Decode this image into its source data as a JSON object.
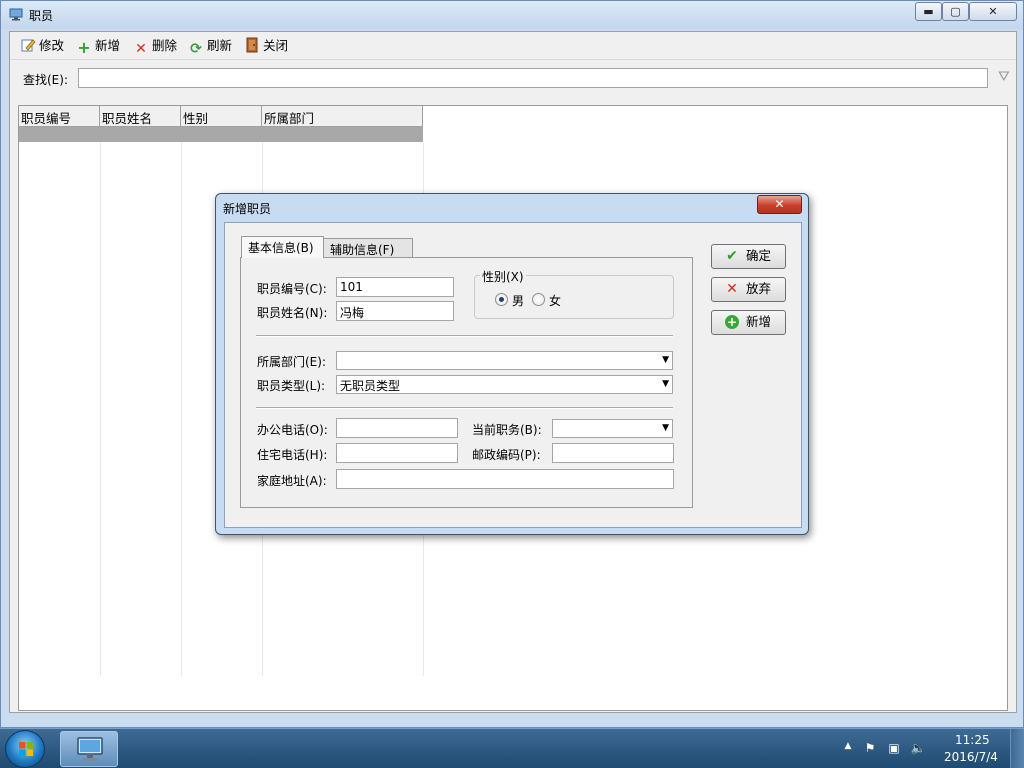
{
  "window": {
    "title": "职员",
    "minimize_label": "▬",
    "maximize_label": "▢",
    "close_label": "✕"
  },
  "toolbar": {
    "edit_label": "修改",
    "add_label": "新增",
    "delete_label": "删除",
    "refresh_label": "刷新",
    "close_label": "关闭"
  },
  "search": {
    "label": "查找(E):",
    "value": ""
  },
  "grid": {
    "columns": [
      "职员编号",
      "职员姓名",
      "性别",
      "所属部门"
    ],
    "rows": []
  },
  "dialog": {
    "title": "新增职员",
    "close_label": "✕",
    "tabs": [
      {
        "label": "基本信息(B)",
        "active": true
      },
      {
        "label": "辅助信息(F)",
        "active": false
      }
    ],
    "fields": {
      "emp_no_label": "职员编号(C):",
      "emp_no_value": "101",
      "emp_name_label": "职员姓名(N):",
      "emp_name_value": "冯梅",
      "sex_group_label": "性别(X)",
      "sex_male_label": "男",
      "sex_female_label": "女",
      "sex_selected": "男",
      "dept_label": "所属部门(E):",
      "dept_value": "",
      "type_label": "职员类型(L):",
      "type_value": "无职员类型",
      "office_phone_label": "办公电话(O):",
      "office_phone_value": "",
      "position_label": "当前职务(B):",
      "position_value": "",
      "home_phone_label": "住宅电话(H):",
      "home_phone_value": "",
      "zip_label": "邮政编码(P):",
      "zip_value": "",
      "address_label": "家庭地址(A):",
      "address_value": ""
    },
    "buttons": {
      "ok_label": "确定",
      "discard_label": "放弃",
      "new_label": "新增"
    }
  },
  "taskbar": {
    "time": "11:25",
    "date": "2016/7/4"
  }
}
